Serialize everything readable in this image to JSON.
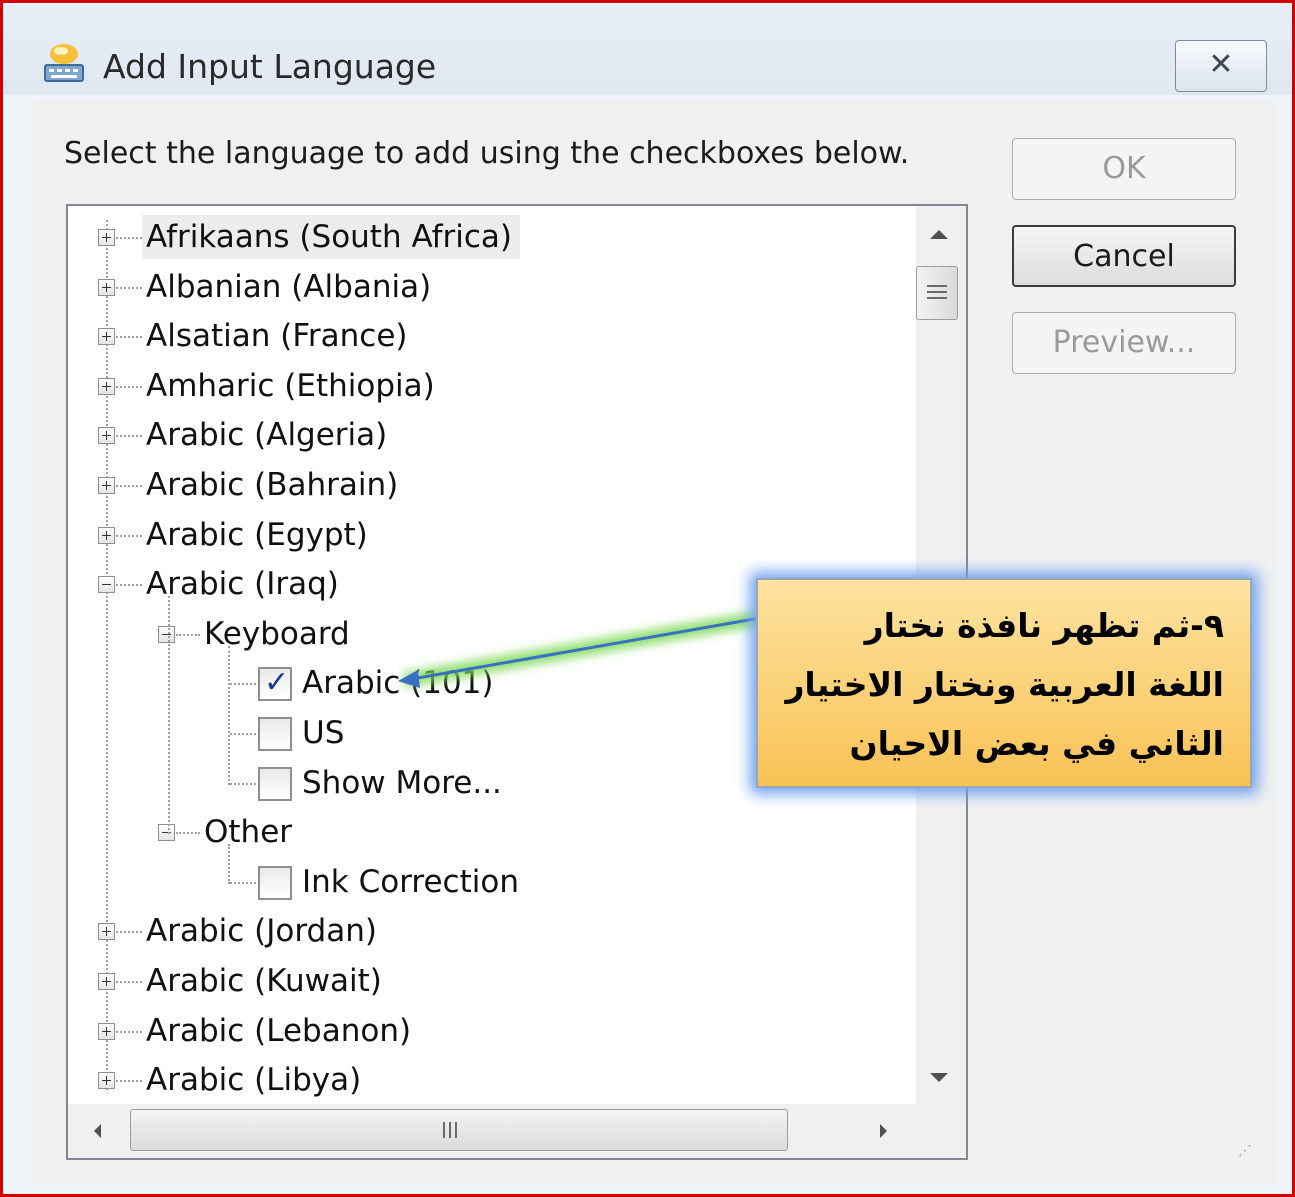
{
  "window": {
    "title": "Add Input Language",
    "close_label": "✕",
    "icon": "keyboard-language-icon"
  },
  "instruction": "Select the language to add using the checkboxes below.",
  "buttons": {
    "ok": "OK",
    "cancel": "Cancel",
    "preview": "Preview..."
  },
  "tree": {
    "languages_before": [
      "Afrikaans (South Africa)",
      "Albanian (Albania)",
      "Alsatian (France)",
      "Amharic (Ethiopia)",
      "Arabic (Algeria)",
      "Arabic (Bahrain)",
      "Arabic (Egypt)"
    ],
    "expanded_language": "Arabic (Iraq)",
    "keyboard_group": "Keyboard",
    "keyboards": [
      {
        "label": "Arabic (101)",
        "checked": true
      },
      {
        "label": "US",
        "checked": false
      },
      {
        "label": "Show More...",
        "checked": false
      }
    ],
    "other_group": "Other",
    "other_items": [
      {
        "label": "Ink Correction",
        "checked": false
      }
    ],
    "languages_after": [
      "Arabic (Jordan)",
      "Arabic (Kuwait)",
      "Arabic (Lebanon)",
      "Arabic (Libya)"
    ]
  },
  "scrollbar": {
    "h_thumb_label": "III"
  },
  "callout": {
    "text": "٩-ثم تظهر نافذة نختار اللغة العربية ونختار الاختيار الثاني في بعض الاحيان",
    "colors": {
      "fill": "#f8c255",
      "glow": "#6ea2ef",
      "arrow": "#3a6fc4",
      "arrow_glow": "#7ed957"
    }
  },
  "colors": {
    "frame_border": "#d40000",
    "dialog_bg": "#f0f0f0"
  }
}
